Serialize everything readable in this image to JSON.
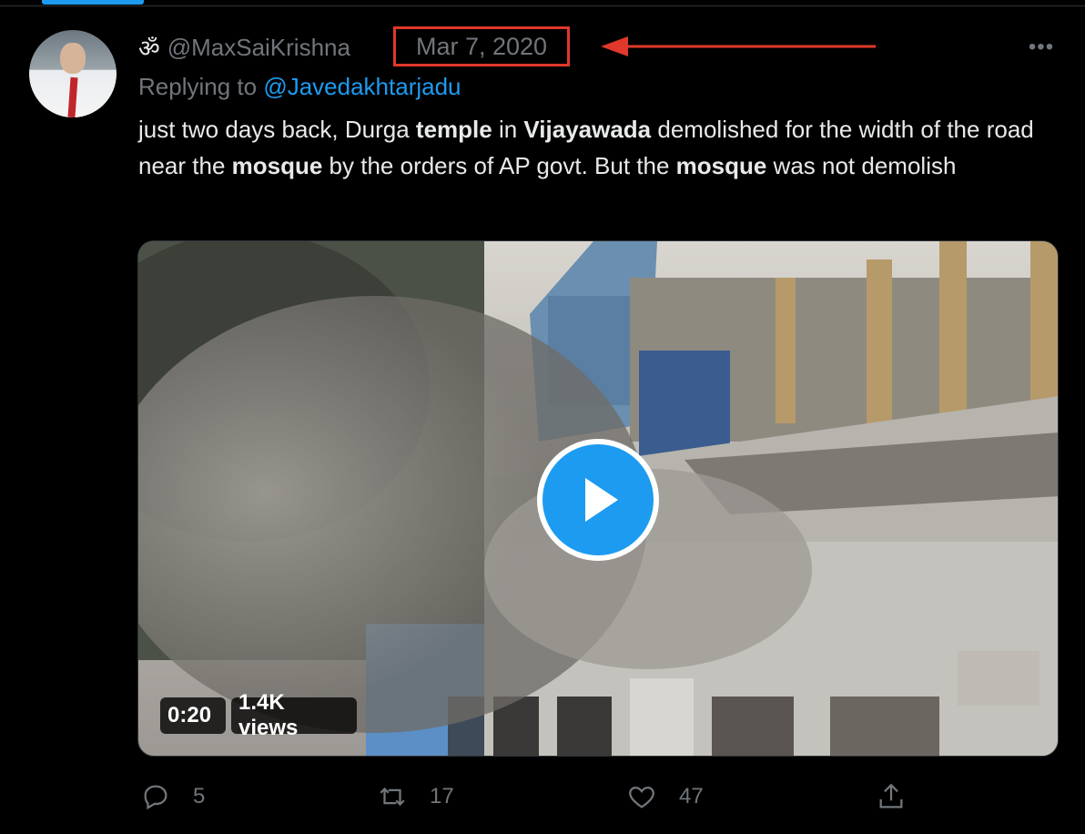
{
  "tweet": {
    "display_name_icon": "ॐ",
    "handle": "@MaxSaiKrishna",
    "date": "Mar 7, 2020",
    "reply_prefix": "Replying to",
    "reply_to": "@Javedakhtarjadu",
    "text_parts": [
      {
        "t": "just two days back, Durga ",
        "b": false
      },
      {
        "t": "temple",
        "b": true
      },
      {
        "t": " in ",
        "b": false
      },
      {
        "t": "Vijayawada",
        "b": true
      },
      {
        "t": " demolished  for the width of the road near the ",
        "b": false
      },
      {
        "t": "mosque",
        "b": true
      },
      {
        "t": " by the orders of AP govt. But the ",
        "b": false
      },
      {
        "t": "mosque",
        "b": true
      },
      {
        "t": " was not demolish",
        "b": false
      }
    ],
    "more_label": "•••"
  },
  "video": {
    "duration": "0:20",
    "views": "1.4K views"
  },
  "actions": {
    "reply_count": "5",
    "retweet_count": "17",
    "like_count": "47"
  },
  "icons": {
    "reply": "reply-icon",
    "retweet": "retweet-icon",
    "like": "heart-icon",
    "share": "share-icon",
    "play": "play-icon",
    "more": "more-icon"
  },
  "colors": {
    "background": "#000000",
    "accent": "#1d9bf0",
    "highlight_box": "#e0382a",
    "muted_text": "#71767b"
  }
}
